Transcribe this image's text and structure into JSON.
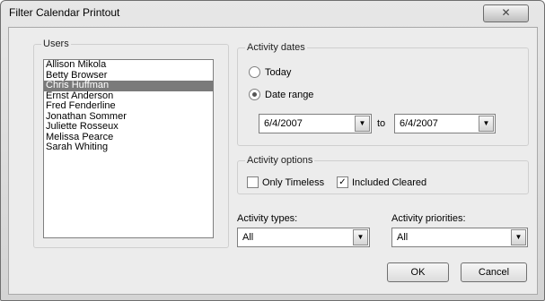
{
  "window": {
    "title": "Filter Calendar Printout",
    "close_glyph": "✕"
  },
  "users": {
    "label": "Users",
    "items": [
      "Allison Mikola",
      "Betty Browser",
      "Chris Huffman",
      "Ernst Anderson",
      "Fred Fenderline",
      "Jonathan Sommer",
      "Juliette Rosseux",
      "Melissa Pearce",
      "Sarah Whiting"
    ],
    "selected": "Chris Huffman"
  },
  "activity_dates": {
    "label": "Activity dates",
    "today_label": "Today",
    "date_range_label": "Date range",
    "selected_option": "Date range",
    "from_value": "6/4/2007",
    "to_label": "to",
    "to_value": "6/4/2007"
  },
  "activity_options": {
    "label": "Activity options",
    "only_timeless_label": "Only Timeless",
    "only_timeless_checked": false,
    "included_cleared_label": "Included Cleared",
    "included_cleared_checked": true
  },
  "activity_types": {
    "label": "Activity types:",
    "value": "All"
  },
  "activity_priorities": {
    "label": "Activity priorities:",
    "value": "All"
  },
  "buttons": {
    "ok_label": "OK",
    "cancel_label": "Cancel"
  },
  "icons": {
    "dropdown_arrow": "▼",
    "checkmark": "✓"
  }
}
